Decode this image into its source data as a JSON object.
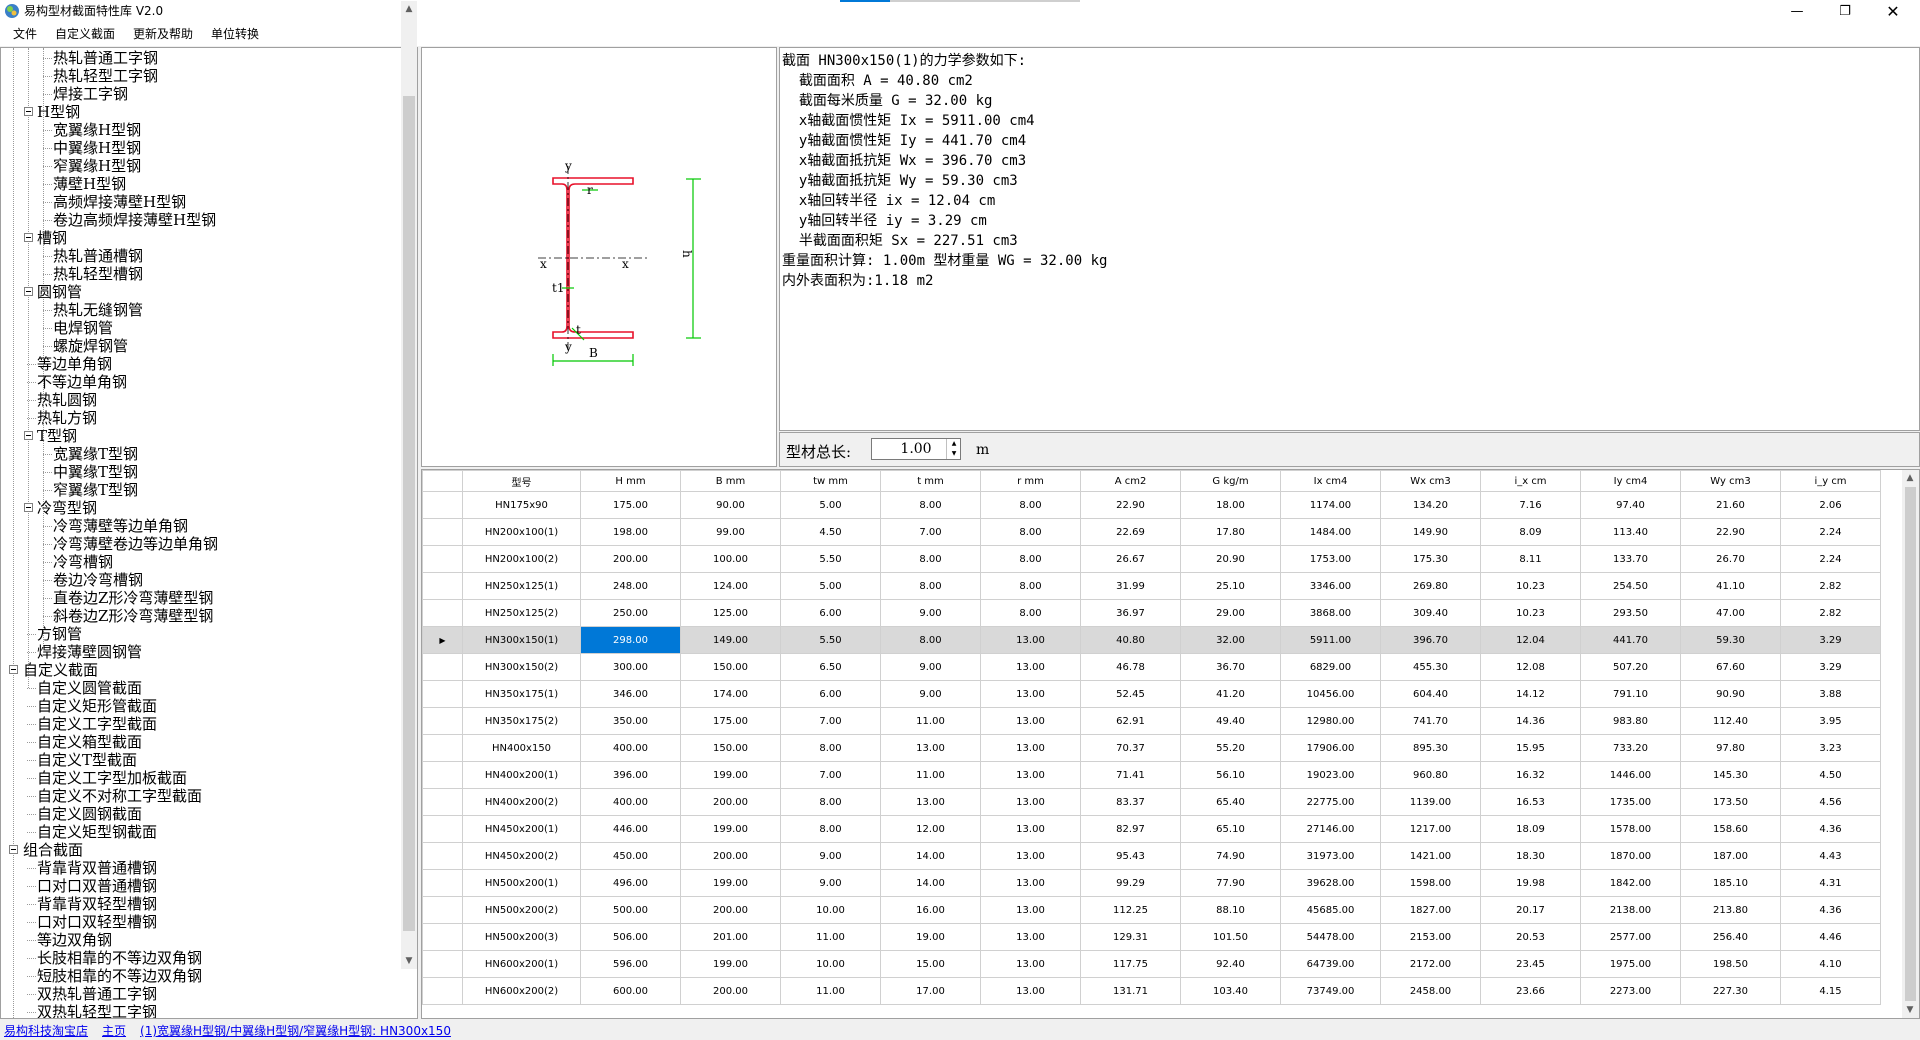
{
  "window": {
    "title": "易构型材截面特性库 V2.0",
    "icon": "app-logo-icon",
    "controls": [
      "minimize-icon",
      "maximize-icon",
      "close-icon"
    ]
  },
  "menu": [
    "文件",
    "自定义截面",
    "更新及帮助",
    "单位转换"
  ],
  "tree": [
    {
      "label": "热轧普通工字钢",
      "level": 3
    },
    {
      "label": "热轧轻型工字钢",
      "level": 3
    },
    {
      "label": "焊接工字钢",
      "level": 3
    },
    {
      "label": "H型钢",
      "level": 2,
      "expanded": true
    },
    {
      "label": "宽翼缘H型钢",
      "level": 3
    },
    {
      "label": "中翼缘H型钢",
      "level": 3
    },
    {
      "label": "窄翼缘H型钢",
      "level": 3
    },
    {
      "label": "薄壁H型钢",
      "level": 3
    },
    {
      "label": "高频焊接薄壁H型钢",
      "level": 3
    },
    {
      "label": "卷边高频焊接薄壁H型钢",
      "level": 3
    },
    {
      "label": "槽钢",
      "level": 2,
      "expanded": true
    },
    {
      "label": "热轧普通槽钢",
      "level": 3
    },
    {
      "label": "热轧轻型槽钢",
      "level": 3
    },
    {
      "label": "圆钢管",
      "level": 2,
      "expanded": true
    },
    {
      "label": "热轧无缝钢管",
      "level": 3
    },
    {
      "label": "电焊钢管",
      "level": 3
    },
    {
      "label": "螺旋焊钢管",
      "level": 3
    },
    {
      "label": "等边单角钢",
      "level": 2
    },
    {
      "label": "不等边单角钢",
      "level": 2
    },
    {
      "label": "热轧圆钢",
      "level": 2
    },
    {
      "label": "热轧方钢",
      "level": 2
    },
    {
      "label": "T型钢",
      "level": 2,
      "expanded": true
    },
    {
      "label": "宽翼缘T型钢",
      "level": 3
    },
    {
      "label": "中翼缘T型钢",
      "level": 3
    },
    {
      "label": "窄翼缘T型钢",
      "level": 3
    },
    {
      "label": "冷弯型钢",
      "level": 2,
      "expanded": true
    },
    {
      "label": "冷弯薄壁等边单角钢",
      "level": 3
    },
    {
      "label": "冷弯薄壁卷边等边单角钢",
      "level": 3
    },
    {
      "label": "冷弯槽钢",
      "level": 3
    },
    {
      "label": "卷边冷弯槽钢",
      "level": 3
    },
    {
      "label": "直卷边Z形冷弯薄壁型钢",
      "level": 3
    },
    {
      "label": "斜卷边Z形冷弯薄壁型钢",
      "level": 3
    },
    {
      "label": "方钢管",
      "level": 2
    },
    {
      "label": "焊接薄壁圆钢管",
      "level": 2
    },
    {
      "label": "自定义截面",
      "level": 1,
      "expanded": true
    },
    {
      "label": "自定义圆管截面",
      "level": 2
    },
    {
      "label": "自定义矩形管截面",
      "level": 2
    },
    {
      "label": "自定义工字型截面",
      "level": 2
    },
    {
      "label": "自定义箱型截面",
      "level": 2
    },
    {
      "label": "自定义T型截面",
      "level": 2
    },
    {
      "label": "自定义工字型加板截面",
      "level": 2
    },
    {
      "label": "自定义不对称工字型截面",
      "level": 2
    },
    {
      "label": "自定义圆钢截面",
      "level": 2
    },
    {
      "label": "自定义矩型钢截面",
      "level": 2
    },
    {
      "label": "组合截面",
      "level": 1,
      "expanded": true
    },
    {
      "label": "背靠背双普通槽钢",
      "level": 2
    },
    {
      "label": "口对口双普通槽钢",
      "level": 2
    },
    {
      "label": "背靠背双轻型槽钢",
      "level": 2
    },
    {
      "label": "口对口双轻型槽钢",
      "level": 2
    },
    {
      "label": "等边双角钢",
      "level": 2
    },
    {
      "label": "长肢相靠的不等边双角钢",
      "level": 2
    },
    {
      "label": "短肢相靠的不等边双角钢",
      "level": 2
    },
    {
      "label": "双热轧普通工字钢",
      "level": 2
    },
    {
      "label": "双热轧轻型工字钢",
      "level": 2
    }
  ],
  "drawing": {
    "labels": {
      "y_top": "y",
      "y_bottom": "y",
      "x_left": "x",
      "x_right": "x",
      "r": "r",
      "t1": "t1",
      "t": "t",
      "B": "B",
      "h": "h"
    },
    "section_color": "#e8102a",
    "dimension_color": "#00c800"
  },
  "result": {
    "lines": [
      "截面 HN300x150(1)的力学参数如下:",
      "  截面面积 A = 40.80 cm2",
      "  截面每米质量 G = 32.00 kg",
      "  x轴截面惯性矩 Ix = 5911.00 cm4",
      "  y轴截面惯性矩 Iy = 441.70 cm4",
      "  x轴截面抵抗矩 Wx = 396.70 cm3",
      "  y轴截面抵抗矩 Wy = 59.30 cm3",
      "  x轴回转半径 ix = 12.04 cm",
      "  y轴回转半径 iy = 3.29 cm",
      "  半截面面积矩 Sx = 227.51 cm3",
      "重量面积计算: 1.00m 型材重量 WG = 32.00 kg",
      "内外表面积为:1.18 m2"
    ]
  },
  "length": {
    "label": "型材总长:",
    "value": "1.00",
    "unit": "m"
  },
  "grid": {
    "columns": [
      "型号",
      "H mm",
      "B mm",
      "tw mm",
      "t mm",
      "r mm",
      "A cm2",
      "G kg/m",
      "Ix cm4",
      "Wx cm3",
      "i_x cm",
      "Iy cm4",
      "Wy cm3",
      "i_y cm"
    ],
    "rows": [
      [
        "HN175x90",
        "175.00",
        "90.00",
        "5.00",
        "8.00",
        "8.00",
        "22.90",
        "18.00",
        "1174.00",
        "134.20",
        "7.16",
        "97.40",
        "21.60",
        "2.06"
      ],
      [
        "HN200x100(1)",
        "198.00",
        "99.00",
        "4.50",
        "7.00",
        "8.00",
        "22.69",
        "17.80",
        "1484.00",
        "149.90",
        "8.09",
        "113.40",
        "22.90",
        "2.24"
      ],
      [
        "HN200x100(2)",
        "200.00",
        "100.00",
        "5.50",
        "8.00",
        "8.00",
        "26.67",
        "20.90",
        "1753.00",
        "175.30",
        "8.11",
        "133.70",
        "26.70",
        "2.24"
      ],
      [
        "HN250x125(1)",
        "248.00",
        "124.00",
        "5.00",
        "8.00",
        "8.00",
        "31.99",
        "25.10",
        "3346.00",
        "269.80",
        "10.23",
        "254.50",
        "41.10",
        "2.82"
      ],
      [
        "HN250x125(2)",
        "250.00",
        "125.00",
        "6.00",
        "9.00",
        "8.00",
        "36.97",
        "29.00",
        "3868.00",
        "309.40",
        "10.23",
        "293.50",
        "47.00",
        "2.82"
      ],
      [
        "HN300x150(1)",
        "298.00",
        "149.00",
        "5.50",
        "8.00",
        "13.00",
        "40.80",
        "32.00",
        "5911.00",
        "396.70",
        "12.04",
        "441.70",
        "59.30",
        "3.29"
      ],
      [
        "HN300x150(2)",
        "300.00",
        "150.00",
        "6.50",
        "9.00",
        "13.00",
        "46.78",
        "36.70",
        "6829.00",
        "455.30",
        "12.08",
        "507.20",
        "67.60",
        "3.29"
      ],
      [
        "HN350x175(1)",
        "346.00",
        "174.00",
        "6.00",
        "9.00",
        "13.00",
        "52.45",
        "41.20",
        "10456.00",
        "604.40",
        "14.12",
        "791.10",
        "90.90",
        "3.88"
      ],
      [
        "HN350x175(2)",
        "350.00",
        "175.00",
        "7.00",
        "11.00",
        "13.00",
        "62.91",
        "49.40",
        "12980.00",
        "741.70",
        "14.36",
        "983.80",
        "112.40",
        "3.95"
      ],
      [
        "HN400x150",
        "400.00",
        "150.00",
        "8.00",
        "13.00",
        "13.00",
        "70.37",
        "55.20",
        "17906.00",
        "895.30",
        "15.95",
        "733.20",
        "97.80",
        "3.23"
      ],
      [
        "HN400x200(1)",
        "396.00",
        "199.00",
        "7.00",
        "11.00",
        "13.00",
        "71.41",
        "56.10",
        "19023.00",
        "960.80",
        "16.32",
        "1446.00",
        "145.30",
        "4.50"
      ],
      [
        "HN400x200(2)",
        "400.00",
        "200.00",
        "8.00",
        "13.00",
        "13.00",
        "83.37",
        "65.40",
        "22775.00",
        "1139.00",
        "16.53",
        "1735.00",
        "173.50",
        "4.56"
      ],
      [
        "HN450x200(1)",
        "446.00",
        "199.00",
        "8.00",
        "12.00",
        "13.00",
        "82.97",
        "65.10",
        "27146.00",
        "1217.00",
        "18.09",
        "1578.00",
        "158.60",
        "4.36"
      ],
      [
        "HN450x200(2)",
        "450.00",
        "200.00",
        "9.00",
        "14.00",
        "13.00",
        "95.43",
        "74.90",
        "31973.00",
        "1421.00",
        "18.30",
        "1870.00",
        "187.00",
        "4.43"
      ],
      [
        "HN500x200(1)",
        "496.00",
        "199.00",
        "9.00",
        "14.00",
        "13.00",
        "99.29",
        "77.90",
        "39628.00",
        "1598.00",
        "19.98",
        "1842.00",
        "185.10",
        "4.31"
      ],
      [
        "HN500x200(2)",
        "500.00",
        "200.00",
        "10.00",
        "16.00",
        "13.00",
        "112.25",
        "88.10",
        "45685.00",
        "1827.00",
        "20.17",
        "2138.00",
        "213.80",
        "4.36"
      ],
      [
        "HN500x200(3)",
        "506.00",
        "201.00",
        "11.00",
        "19.00",
        "13.00",
        "129.31",
        "101.50",
        "54478.00",
        "2153.00",
        "20.53",
        "2577.00",
        "256.40",
        "4.46"
      ],
      [
        "HN600x200(1)",
        "596.00",
        "199.00",
        "10.00",
        "15.00",
        "13.00",
        "117.75",
        "92.40",
        "64739.00",
        "2172.00",
        "23.45",
        "1975.00",
        "198.50",
        "4.10"
      ],
      [
        "HN600x200(2)",
        "600.00",
        "200.00",
        "11.00",
        "17.00",
        "13.00",
        "131.71",
        "103.40",
        "73749.00",
        "2458.00",
        "23.66",
        "2273.00",
        "227.30",
        "4.15"
      ]
    ],
    "selected_row": 5
  },
  "status": {
    "links": [
      "易构科技淘宝店",
      "主页",
      "(1)宽翼缘H型钢/中翼缘H型钢/窄翼缘H型钢: HN300x150"
    ]
  }
}
